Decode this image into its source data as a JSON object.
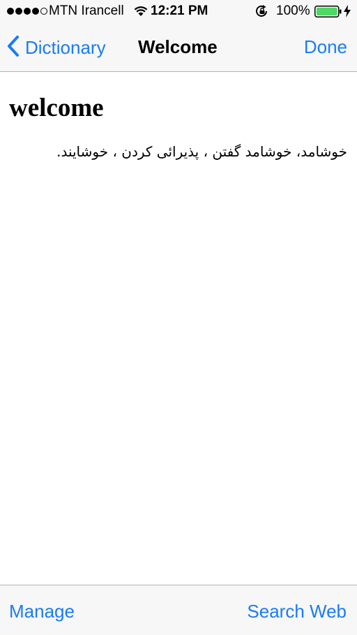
{
  "status_bar": {
    "carrier": "MTN Irancell",
    "time": "12:21 PM",
    "battery_percent": "100%",
    "signal_bars_filled": 4,
    "signal_bars_total": 5,
    "battery_level": 1.0
  },
  "nav": {
    "back_label": "Dictionary",
    "title": "Welcome",
    "done_label": "Done"
  },
  "entry": {
    "headword": "welcome",
    "definition": "خوشامد، خوشامد گفتن ، پذیرائی کردن ، خوشایند."
  },
  "toolbar": {
    "manage_label": "Manage",
    "search_web_label": "Search Web"
  },
  "colors": {
    "accent": "#1a7cf5",
    "battery_fill": "#4cd964",
    "bar_background": "#f7f7f7"
  }
}
